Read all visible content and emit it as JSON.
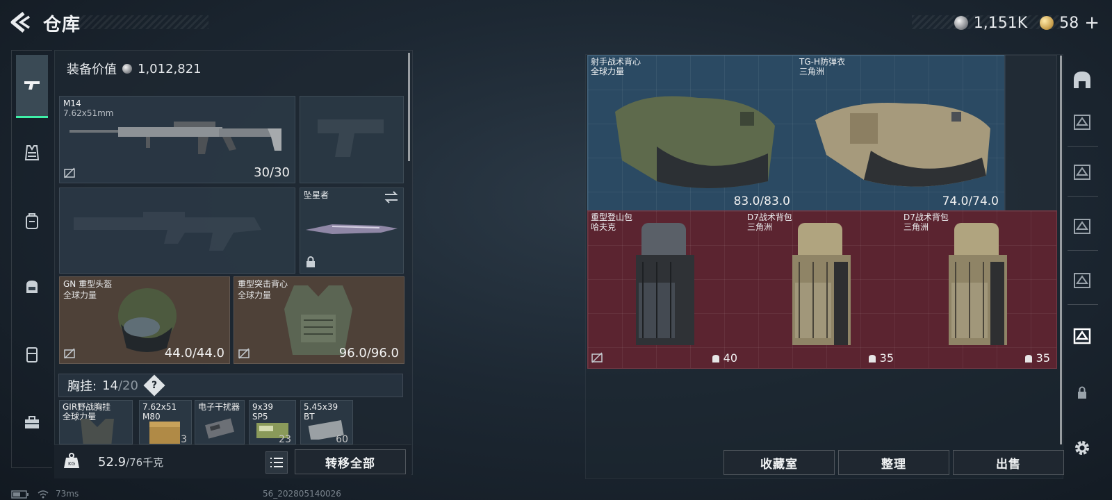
{
  "header": {
    "title": "仓库",
    "back_icon": "back-arrow-icon",
    "currency": [
      {
        "icon": "silver-coin-icon",
        "value": "1,151K"
      },
      {
        "icon": "gold-coin-icon",
        "value": "58"
      }
    ],
    "add_label": "+"
  },
  "left_tabs": [
    {
      "icon": "pistol-icon",
      "active": true
    },
    {
      "icon": "vest-icon"
    },
    {
      "icon": "backpack-icon"
    },
    {
      "icon": "bag-icon"
    },
    {
      "icon": "case-icon"
    },
    {
      "icon": "toolbox-icon"
    }
  ],
  "loadout": {
    "equip_value_label": "装备价值",
    "equip_value": "1,012,821",
    "primary": {
      "name": "M14",
      "caliber": "7.62x51mm",
      "durability": "30/30"
    },
    "secondary_slot_icon": "pistol-silhouette-icon",
    "rifle_slot_icon": "rifle-silhouette-icon",
    "melee": {
      "name": "坠星者"
    },
    "helmet": {
      "name": "GN 重型头盔",
      "source": "全球力量",
      "durability": "44.0/44.0"
    },
    "armor": {
      "name": "重型突击背心",
      "source": "全球力量",
      "durability": "96.0/96.0"
    },
    "chest_label": "胸挂:",
    "chest_used": "14",
    "chest_total": "/20",
    "chest_help": "?",
    "chest_items": [
      {
        "name": "GIR野战胸挂",
        "sub": "全球力量",
        "count": ""
      },
      {
        "name": "7.62x51",
        "sub": "M80",
        "count": "3"
      },
      {
        "name": "电子干扰器",
        "sub": "",
        "count": ""
      },
      {
        "name": "9x39",
        "sub": "SP5",
        "count": "23"
      },
      {
        "name": "5.45x39",
        "sub": "BT",
        "count": "60"
      }
    ],
    "weight_current": "52.9",
    "weight_max": "/76千克",
    "transfer_all": "转移全部"
  },
  "storage": {
    "items": [
      {
        "name": "射手战术背心",
        "source": "全球力量",
        "durability": "83.0/83.0",
        "grid": "blue"
      },
      {
        "name": "TG-H防弹衣",
        "source": "三角洲",
        "durability": "74.0/74.0",
        "grid": "blue"
      },
      {
        "name": "重型登山包",
        "source": "哈夫克",
        "capacity": "40",
        "grid": "red"
      },
      {
        "name": "D7战术背包",
        "source": "三角洲",
        "capacity": "35",
        "grid": "red"
      },
      {
        "name": "D7战术背包",
        "source": "三角洲",
        "capacity": "35",
        "grid": "red"
      }
    ],
    "buttons": {
      "collection": "收藏室",
      "organize": "整理",
      "sell": "出售"
    }
  },
  "right_tabs": [
    {
      "icon": "storage-home-icon"
    },
    {
      "icon": "storage-page-1-icon"
    },
    {
      "icon": "storage-page-2-icon"
    },
    {
      "icon": "storage-page-3-icon"
    },
    {
      "icon": "storage-page-4-icon"
    },
    {
      "icon": "storage-page-5-icon",
      "active": true
    },
    {
      "icon": "lock-icon"
    },
    {
      "icon": "settings-gear-icon"
    }
  ],
  "status": {
    "ping": "73ms",
    "build": "56_202805140026"
  },
  "colors": {
    "accent": "#3ff0a8",
    "grid_blue": "#2b4a63",
    "grid_red": "#5b2430",
    "brown_slot": "#4e4138"
  }
}
